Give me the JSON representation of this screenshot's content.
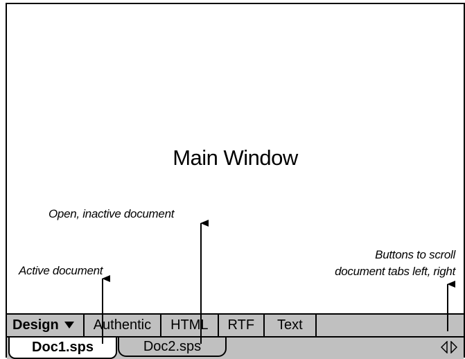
{
  "main_window": {
    "title": "Main Window"
  },
  "callouts": {
    "inactive": "Open, inactive document",
    "active": "Active document",
    "scroll_line1": "Buttons to scroll",
    "scroll_line2": "document tabs left, right"
  },
  "view_tabs": [
    {
      "label": "Design",
      "active": true
    },
    {
      "label": "Authentic"
    },
    {
      "label": "HTML"
    },
    {
      "label": "RTF"
    },
    {
      "label": "Text"
    }
  ],
  "design_dropdown_icon": "triangle-down-icon",
  "doc_tabs": [
    {
      "label": "Doc1.sps",
      "state": "active"
    },
    {
      "label": "Doc2.sps",
      "state": "inactive"
    }
  ],
  "scroll_buttons": {
    "left_icon": "triangle-left-icon",
    "right_icon": "triangle-right-icon"
  },
  "colors": {
    "bar_bg": "#c0c0c0",
    "border": "#000000",
    "page_bg": "#ffffff"
  }
}
